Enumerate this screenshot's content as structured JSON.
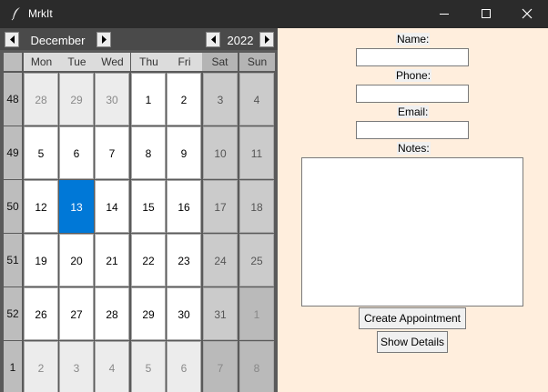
{
  "window": {
    "title": "MrkIt",
    "icon": "feather-icon",
    "controls": [
      "minimize-icon",
      "maximize-icon",
      "close-icon"
    ],
    "titlebar_color": "#2b2b2b"
  },
  "calendar": {
    "month": "December",
    "year": "2022",
    "weekday_headers": [
      "Mon",
      "Tue",
      "Wed",
      "Thu",
      "Fri",
      "Sat",
      "Sun"
    ],
    "selected_day": "13",
    "selected_color": "#0078d7",
    "weeks": [
      {
        "week": "48",
        "days": [
          "28",
          "29",
          "30",
          "1",
          "2",
          "3",
          "4"
        ]
      },
      {
        "week": "49",
        "days": [
          "5",
          "6",
          "7",
          "8",
          "9",
          "10",
          "11"
        ]
      },
      {
        "week": "50",
        "days": [
          "12",
          "13",
          "14",
          "15",
          "16",
          "17",
          "18"
        ]
      },
      {
        "week": "51",
        "days": [
          "19",
          "20",
          "21",
          "22",
          "23",
          "24",
          "25"
        ]
      },
      {
        "week": "52",
        "days": [
          "26",
          "27",
          "28",
          "29",
          "30",
          "31",
          "1"
        ]
      },
      {
        "week": "1",
        "days": [
          "2",
          "3",
          "4",
          "5",
          "6",
          "7",
          "8"
        ]
      }
    ]
  },
  "form": {
    "name_label": "Name:",
    "name_value": "",
    "phone_label": "Phone:",
    "phone_value": "",
    "email_label": "Email:",
    "email_value": "",
    "notes_label": "Notes:",
    "notes_value": "",
    "create_button": "Create Appointment",
    "details_button": "Show Details",
    "background_color": "#ffeedd"
  }
}
